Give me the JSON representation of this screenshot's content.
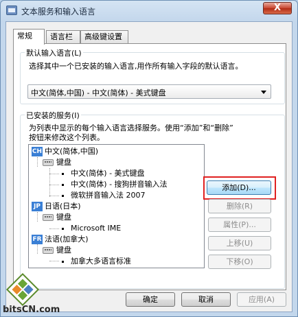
{
  "window": {
    "title": "文本服务和输入语言",
    "close_label": "X"
  },
  "tabs": [
    {
      "label": "常规",
      "active": true
    },
    {
      "label": "语言栏",
      "active": false
    },
    {
      "label": "高级键设置",
      "active": false
    }
  ],
  "default_language": {
    "group_title": "默认输入语言(L)",
    "description": "选择其中一个已安装的输入语言,用作所有输入字段的默认语言。",
    "selected": "中文(简体,中国) - 中文(简体) - 美式键盘"
  },
  "installed_services": {
    "group_title": "已安装的服务(I)",
    "description_line1": "为列表中显示的每个输入语言选择服务。使用“添加”和“删除”",
    "description_line2": "按钮来修改这个列表。",
    "tree": {
      "lang1": {
        "badge": "CH",
        "label": "中文(简体,中国)"
      },
      "lang1_group": "键盘",
      "lang1_items": [
        "中文(简体) - 美式键盘",
        "中文(简体) - 搜狗拼音输入法",
        "微软拼音输入法 2007"
      ],
      "lang2": {
        "badge": "JP",
        "label": "日语(日本)"
      },
      "lang2_group": "键盘",
      "lang2_items": [
        "Microsoft IME"
      ],
      "lang3": {
        "badge": "FR",
        "label": "法语(加拿大)"
      },
      "lang3_group": "键盘",
      "lang3_items": [
        "加拿大多语言标准"
      ]
    },
    "buttons": {
      "add": "添加(D)...",
      "remove": "删除(R)",
      "properties": "属性(P)...",
      "move_up": "上移(U)",
      "move_down": "下移(O)"
    }
  },
  "footer": {
    "ok": "确定",
    "cancel": "取消",
    "apply": "应用(A)"
  },
  "watermark": "bitsCN.com",
  "colors": {
    "highlight": "#e02020",
    "lang_badge": "#3a7fd5"
  }
}
